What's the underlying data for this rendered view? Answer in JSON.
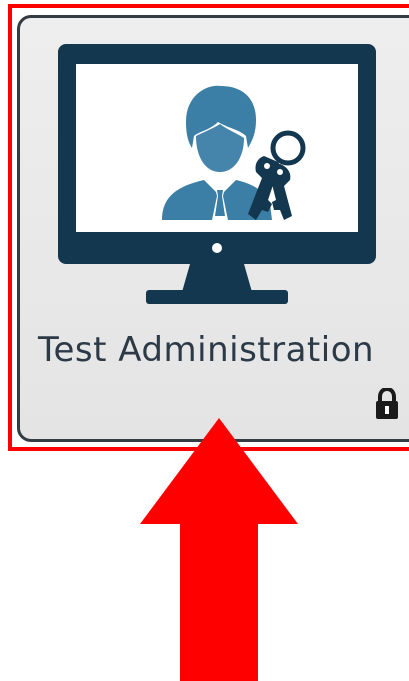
{
  "tile": {
    "label": "Test Administration",
    "icon": "monitor-user-key-icon",
    "lock_icon": "lock-icon"
  },
  "annotation": {
    "highlight_color": "#ff0000",
    "arrow_color": "#ff0000"
  },
  "colors": {
    "monitor": "#13374f",
    "screen": "#ffffff",
    "person": "#3b7ea6",
    "label": "#2c3a47"
  }
}
